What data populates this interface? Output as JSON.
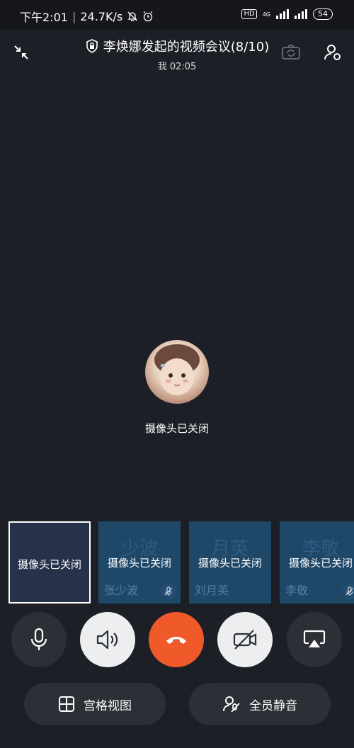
{
  "status_bar": {
    "time": "下午2:01",
    "speed": "24.7K/s",
    "hd": "HD",
    "network": "4G",
    "battery": "54"
  },
  "header": {
    "title": "李焕娜发起的视频会议(8/10)",
    "subtitle": "我 02:05"
  },
  "main": {
    "camera_off_text": "摄像头已关闭"
  },
  "participants": [
    {
      "status": "摄像头已关闭",
      "ghost": "",
      "name": ""
    },
    {
      "status": "摄像头已关闭",
      "ghost": "少波",
      "name": "张少波"
    },
    {
      "status": "摄像头已关闭",
      "ghost": "月英",
      "name": "刘月英"
    },
    {
      "status": "摄像头已关闭",
      "ghost": "李敬",
      "name": "李敬"
    }
  ],
  "bottom_buttons": {
    "grid_view": "宫格视图",
    "mute_all": "全员静音"
  },
  "colors": {
    "background": "#1c1f26",
    "hangup": "#f05a2a",
    "tile": "#1e4768"
  }
}
